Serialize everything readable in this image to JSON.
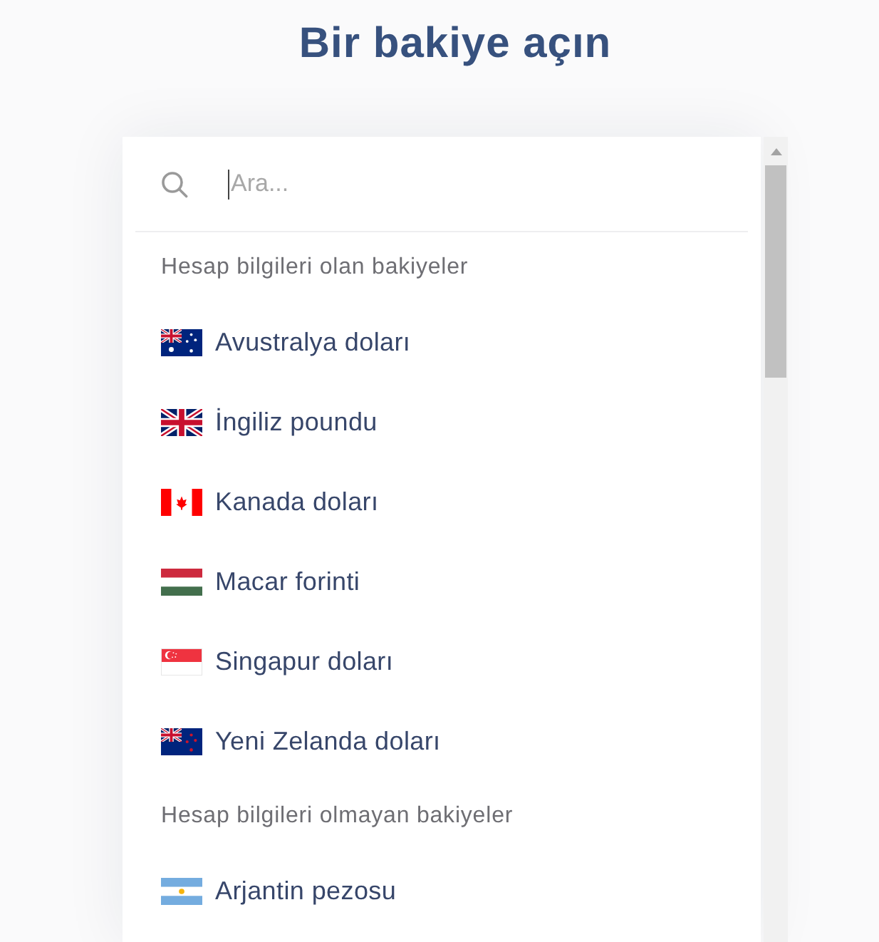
{
  "title": "Bir bakiye açın",
  "search": {
    "placeholder": "Ara...",
    "focused": true
  },
  "sections": [
    {
      "heading": "Hesap bilgileri olan bakiyeler",
      "items": [
        {
          "kind": "au",
          "label": "Avustralya doları"
        },
        {
          "kind": "gb",
          "label": "İngiliz poundu"
        },
        {
          "kind": "ca",
          "label": "Kanada doları"
        },
        {
          "kind": "hu",
          "label": "Macar forinti"
        },
        {
          "kind": "sg",
          "label": "Singapur doları"
        },
        {
          "kind": "nz",
          "label": "Yeni Zelanda doları"
        }
      ]
    },
    {
      "heading": "Hesap bilgileri olmayan bakiyeler",
      "items": [
        {
          "kind": "ar",
          "label": "Arjantin pezosu"
        }
      ]
    }
  ]
}
